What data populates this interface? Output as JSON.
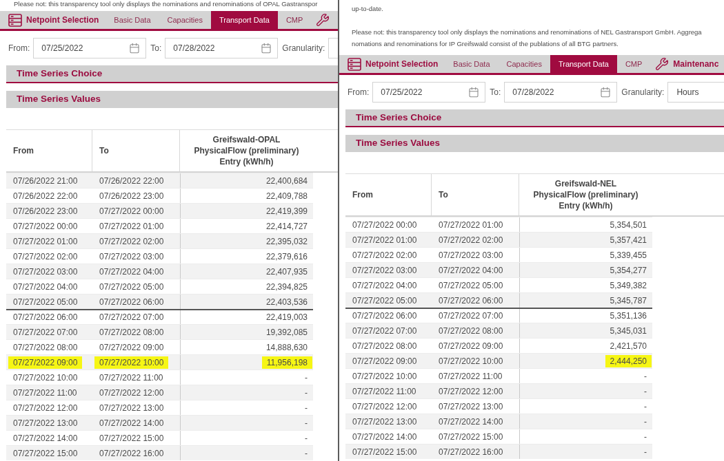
{
  "panels": [
    {
      "notes": [
        {
          "lines": [
            "Please not: this transparency tool only displays the nominations and renominations of OPAL Gastranspor"
          ]
        }
      ],
      "tabs": [
        {
          "kind": "netpoint",
          "label": "Netpoint Selection",
          "selected": false
        },
        {
          "kind": "page",
          "label": "Basic Data",
          "selected": false
        },
        {
          "kind": "page",
          "label": "Capacities",
          "selected": false
        },
        {
          "kind": "page",
          "label": "Transport Data",
          "selected": true
        },
        {
          "kind": "page",
          "label": "CMP",
          "selected": false
        },
        {
          "kind": "maintenance",
          "selected": false
        }
      ],
      "filters": {
        "from_label": "From:",
        "from_value": "07/25/2022",
        "to_label": "To:",
        "to_value": "07/28/2022",
        "granularity_label": "Granularity:"
      },
      "choice_title": "Time Series Choice",
      "values_title": "Time Series Values",
      "table": {
        "columns": [
          {
            "lines": [
              "From"
            ]
          },
          {
            "lines": [
              "To"
            ]
          },
          {
            "lines": [
              "Greifswald-OPAL",
              "PhysicalFlow (preliminary)",
              "Entry (kWh/h)"
            ]
          }
        ],
        "rows": [
          {
            "from": "07/26/2022 21:00",
            "to": "07/26/2022 22:00",
            "value": "22,400,684",
            "shaded": true,
            "divider_above": false,
            "highlight_from": false,
            "highlight_to": false,
            "highlight_value": false
          },
          {
            "from": "07/26/2022 22:00",
            "to": "07/26/2022 23:00",
            "value": "22,409,788",
            "shaded": false,
            "divider_above": false,
            "highlight_from": false,
            "highlight_to": false,
            "highlight_value": false
          },
          {
            "from": "07/26/2022 23:00",
            "to": "07/27/2022 00:00",
            "value": "22,419,399",
            "shaded": true,
            "divider_above": false,
            "highlight_from": false,
            "highlight_to": false,
            "highlight_value": false
          },
          {
            "from": "07/27/2022 00:00",
            "to": "07/27/2022 01:00",
            "value": "22,414,727",
            "shaded": false,
            "divider_above": false,
            "highlight_from": false,
            "highlight_to": false,
            "highlight_value": false
          },
          {
            "from": "07/27/2022 01:00",
            "to": "07/27/2022 02:00",
            "value": "22,395,032",
            "shaded": true,
            "divider_above": false,
            "highlight_from": false,
            "highlight_to": false,
            "highlight_value": false
          },
          {
            "from": "07/27/2022 02:00",
            "to": "07/27/2022 03:00",
            "value": "22,379,616",
            "shaded": false,
            "divider_above": false,
            "highlight_from": false,
            "highlight_to": false,
            "highlight_value": false
          },
          {
            "from": "07/27/2022 03:00",
            "to": "07/27/2022 04:00",
            "value": "22,407,935",
            "shaded": true,
            "divider_above": false,
            "highlight_from": false,
            "highlight_to": false,
            "highlight_value": false
          },
          {
            "from": "07/27/2022 04:00",
            "to": "07/27/2022 05:00",
            "value": "22,394,825",
            "shaded": false,
            "divider_above": false,
            "highlight_from": false,
            "highlight_to": false,
            "highlight_value": false
          },
          {
            "from": "07/27/2022 05:00",
            "to": "07/27/2022 06:00",
            "value": "22,403,536",
            "shaded": true,
            "divider_above": false,
            "highlight_from": false,
            "highlight_to": false,
            "highlight_value": false
          },
          {
            "from": "07/27/2022 06:00",
            "to": "07/27/2022 07:00",
            "value": "22,419,003",
            "shaded": false,
            "divider_above": true,
            "highlight_from": false,
            "highlight_to": false,
            "highlight_value": false
          },
          {
            "from": "07/27/2022 07:00",
            "to": "07/27/2022 08:00",
            "value": "19,392,085",
            "shaded": true,
            "divider_above": false,
            "highlight_from": false,
            "highlight_to": false,
            "highlight_value": false
          },
          {
            "from": "07/27/2022 08:00",
            "to": "07/27/2022 09:00",
            "value": "14,888,630",
            "shaded": false,
            "divider_above": false,
            "highlight_from": false,
            "highlight_to": false,
            "highlight_value": false
          },
          {
            "from": "07/27/2022 09:00",
            "to": "07/27/2022 10:00",
            "value": "11,956,198",
            "shaded": true,
            "divider_above": false,
            "highlight_from": true,
            "highlight_to": true,
            "highlight_value": true
          },
          {
            "from": "07/27/2022 10:00",
            "to": "07/27/2022 11:00",
            "value": "-",
            "shaded": false,
            "divider_above": false,
            "highlight_from": false,
            "highlight_to": false,
            "highlight_value": false
          },
          {
            "from": "07/27/2022 11:00",
            "to": "07/27/2022 12:00",
            "value": "-",
            "shaded": true,
            "divider_above": false,
            "highlight_from": false,
            "highlight_to": false,
            "highlight_value": false
          },
          {
            "from": "07/27/2022 12:00",
            "to": "07/27/2022 13:00",
            "value": "-",
            "shaded": false,
            "divider_above": false,
            "highlight_from": false,
            "highlight_to": false,
            "highlight_value": false
          },
          {
            "from": "07/27/2022 13:00",
            "to": "07/27/2022 14:00",
            "value": "-",
            "shaded": true,
            "divider_above": false,
            "highlight_from": false,
            "highlight_to": false,
            "highlight_value": false
          },
          {
            "from": "07/27/2022 14:00",
            "to": "07/27/2022 15:00",
            "value": "-",
            "shaded": false,
            "divider_above": false,
            "highlight_from": false,
            "highlight_to": false,
            "highlight_value": false
          },
          {
            "from": "07/27/2022 15:00",
            "to": "07/27/2022 16:00",
            "value": "-",
            "shaded": true,
            "divider_above": false,
            "highlight_from": false,
            "highlight_to": false,
            "highlight_value": false
          }
        ]
      }
    },
    {
      "notes": [
        {
          "lines": [
            "up-to-date."
          ]
        },
        {
          "lines": [
            "Please not: this transparency tool only displays the nominations and renominations of NEL Gastransport GmbH. Aggrega",
            "nomations and renominations for IP Greifswald consist of the publations of all BTG partners."
          ]
        }
      ],
      "tabs": [
        {
          "kind": "netpoint",
          "label": "Netpoint Selection",
          "selected": false
        },
        {
          "kind": "page",
          "label": "Basic Data",
          "selected": false
        },
        {
          "kind": "page",
          "label": "Capacities",
          "selected": false
        },
        {
          "kind": "page",
          "label": "Transport Data",
          "selected": true
        },
        {
          "kind": "page",
          "label": "CMP",
          "selected": false
        },
        {
          "kind": "maintenance",
          "label": "Maintenanc",
          "selected": false
        }
      ],
      "filters": {
        "from_label": "From:",
        "from_value": "07/25/2022",
        "to_label": "To:",
        "to_value": "07/28/2022",
        "granularity_label": "Granularity:",
        "granularity_value": "Hours"
      },
      "choice_title": "Time Series Choice",
      "values_title": "Time Series Values",
      "table": {
        "columns": [
          {
            "lines": [
              "From"
            ]
          },
          {
            "lines": [
              "To"
            ]
          },
          {
            "lines": [
              "Greifswald-NEL",
              "PhysicalFlow (preliminary)",
              "Entry (kWh/h)"
            ]
          }
        ],
        "rows": [
          {
            "from": "07/27/2022 00:00",
            "to": "07/27/2022 01:00",
            "value": "5,354,501",
            "shaded": false,
            "divider_above": false,
            "highlight_from": false,
            "highlight_to": false,
            "highlight_value": false
          },
          {
            "from": "07/27/2022 01:00",
            "to": "07/27/2022 02:00",
            "value": "5,357,421",
            "shaded": true,
            "divider_above": false,
            "highlight_from": false,
            "highlight_to": false,
            "highlight_value": false
          },
          {
            "from": "07/27/2022 02:00",
            "to": "07/27/2022 03:00",
            "value": "5,339,455",
            "shaded": false,
            "divider_above": false,
            "highlight_from": false,
            "highlight_to": false,
            "highlight_value": false
          },
          {
            "from": "07/27/2022 03:00",
            "to": "07/27/2022 04:00",
            "value": "5,354,277",
            "shaded": true,
            "divider_above": false,
            "highlight_from": false,
            "highlight_to": false,
            "highlight_value": false
          },
          {
            "from": "07/27/2022 04:00",
            "to": "07/27/2022 05:00",
            "value": "5,349,382",
            "shaded": false,
            "divider_above": false,
            "highlight_from": false,
            "highlight_to": false,
            "highlight_value": false
          },
          {
            "from": "07/27/2022 05:00",
            "to": "07/27/2022 06:00",
            "value": "5,345,787",
            "shaded": true,
            "divider_above": false,
            "highlight_from": false,
            "highlight_to": false,
            "highlight_value": false
          },
          {
            "from": "07/27/2022 06:00",
            "to": "07/27/2022 07:00",
            "value": "5,351,136",
            "shaded": false,
            "divider_above": true,
            "highlight_from": false,
            "highlight_to": false,
            "highlight_value": false
          },
          {
            "from": "07/27/2022 07:00",
            "to": "07/27/2022 08:00",
            "value": "5,345,031",
            "shaded": true,
            "divider_above": false,
            "highlight_from": false,
            "highlight_to": false,
            "highlight_value": false
          },
          {
            "from": "07/27/2022 08:00",
            "to": "07/27/2022 09:00",
            "value": "2,421,570",
            "shaded": false,
            "divider_above": false,
            "highlight_from": false,
            "highlight_to": false,
            "highlight_value": false
          },
          {
            "from": "07/27/2022 09:00",
            "to": "07/27/2022 10:00",
            "value": "2,444,250",
            "shaded": true,
            "divider_above": false,
            "highlight_from": false,
            "highlight_to": false,
            "highlight_value": true
          },
          {
            "from": "07/27/2022 10:00",
            "to": "07/27/2022 11:00",
            "value": "-",
            "shaded": false,
            "divider_above": false,
            "highlight_from": false,
            "highlight_to": false,
            "highlight_value": false
          },
          {
            "from": "07/27/2022 11:00",
            "to": "07/27/2022 12:00",
            "value": "-",
            "shaded": true,
            "divider_above": false,
            "highlight_from": false,
            "highlight_to": false,
            "highlight_value": false
          },
          {
            "from": "07/27/2022 12:00",
            "to": "07/27/2022 13:00",
            "value": "-",
            "shaded": false,
            "divider_above": false,
            "highlight_from": false,
            "highlight_to": false,
            "highlight_value": false
          },
          {
            "from": "07/27/2022 13:00",
            "to": "07/27/2022 14:00",
            "value": "-",
            "shaded": true,
            "divider_above": false,
            "highlight_from": false,
            "highlight_to": false,
            "highlight_value": false
          },
          {
            "from": "07/27/2022 14:00",
            "to": "07/27/2022 15:00",
            "value": "-",
            "shaded": false,
            "divider_above": false,
            "highlight_from": false,
            "highlight_to": false,
            "highlight_value": false
          },
          {
            "from": "07/27/2022 15:00",
            "to": "07/27/2022 16:00",
            "value": "-",
            "shaded": true,
            "divider_above": false,
            "highlight_from": false,
            "highlight_to": false,
            "highlight_value": false
          }
        ]
      }
    }
  ]
}
